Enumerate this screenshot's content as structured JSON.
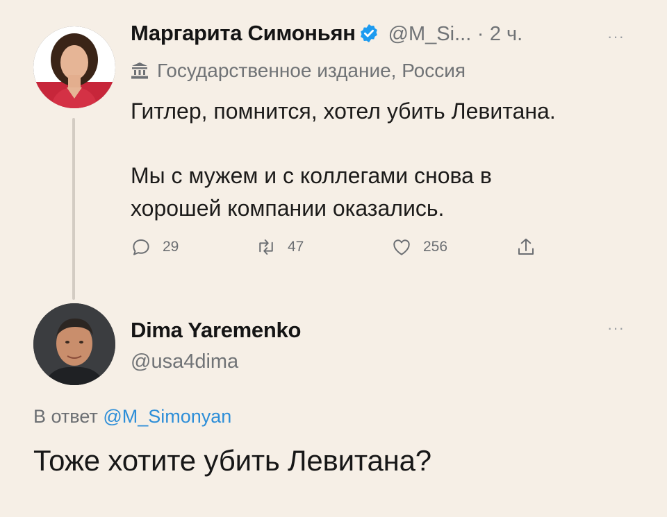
{
  "tweet": {
    "author_name": "Маргарита Симоньян",
    "handle": "@M_Si...",
    "separator": "·",
    "time": "2 ч.",
    "label": "Государственное издание, Россия",
    "paragraph1": "Гитлер, помнится, хотел убить Левитана.",
    "paragraph2_line1": "Мы с мужем и с коллегами снова в",
    "paragraph2_line2": "хорошей компании оказались.",
    "replies": "29",
    "retweets": "47",
    "likes": "256",
    "more": "···"
  },
  "reply": {
    "author_name": "Dima Yaremenko",
    "handle": "@usa4dima",
    "more": "···",
    "replying_prefix": "В ответ",
    "replying_to": "@M_Simonyan",
    "text": "Тоже хотите убить Левитана?"
  },
  "colors": {
    "background": "#f6efe6",
    "verified": "#1d9bf0",
    "link": "#2d8ed8",
    "muted": "#707376"
  },
  "icons": [
    "verified-badge-icon",
    "state-media-icon",
    "reply-icon",
    "retweet-icon",
    "like-icon",
    "share-icon",
    "more-icon"
  ]
}
